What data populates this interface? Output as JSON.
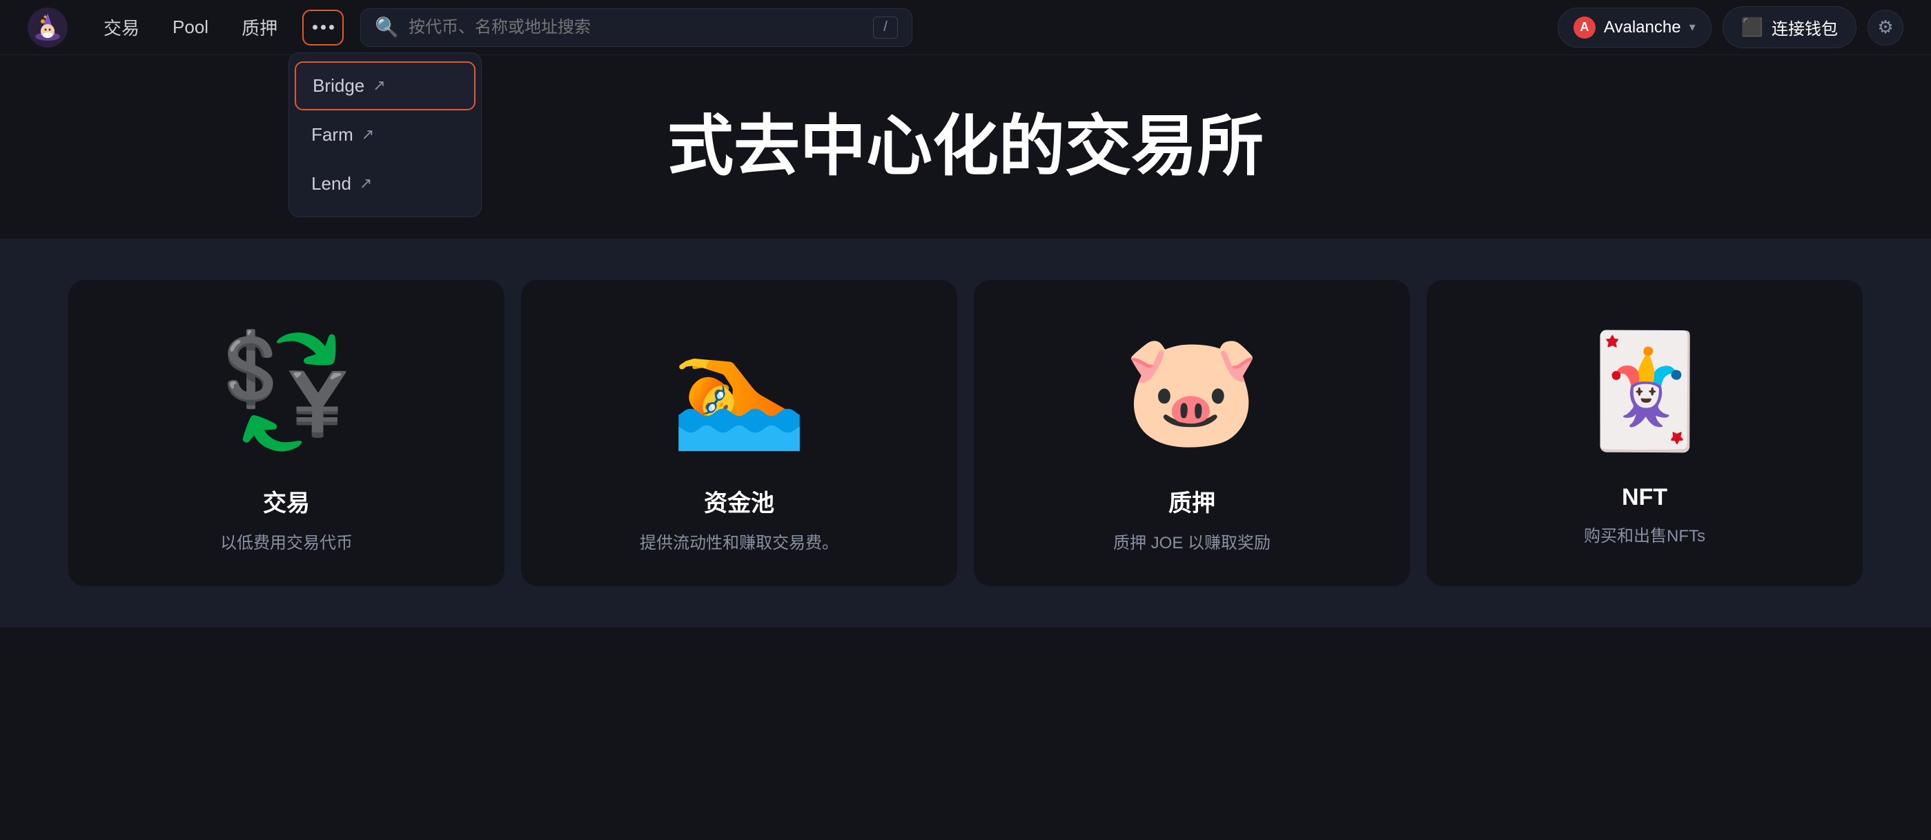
{
  "app": {
    "logo_alt": "Trader Joe logo"
  },
  "navbar": {
    "links": [
      {
        "id": "trade",
        "label": "交易"
      },
      {
        "id": "pool",
        "label": "Pool"
      },
      {
        "id": "stake",
        "label": "质押"
      }
    ],
    "more_button_label": "•••",
    "search_placeholder": "按代币、名称或地址搜索",
    "search_slash": "/",
    "network": {
      "name": "Avalanche",
      "icon": "A"
    },
    "connect_wallet": "连接钱包"
  },
  "dropdown": {
    "items": [
      {
        "id": "bridge",
        "label": "Bridge",
        "external": true,
        "highlighted": true
      },
      {
        "id": "farm",
        "label": "Farm",
        "external": true,
        "highlighted": false
      },
      {
        "id": "lend",
        "label": "Lend",
        "external": true,
        "highlighted": false
      }
    ]
  },
  "hero": {
    "title": "式去中心化的交易所"
  },
  "cards": [
    {
      "id": "trade",
      "emoji": "💱",
      "title": "交易",
      "desc": "以低费用交易代币"
    },
    {
      "id": "pool",
      "emoji": "🏊",
      "title": "资金池",
      "desc": "提供流动性和赚取交易费。"
    },
    {
      "id": "stake",
      "emoji": "🐷",
      "title": "质押",
      "desc": "质押 JOE 以赚取奖励"
    },
    {
      "id": "nft",
      "emoji": "🃏",
      "title": "NFT",
      "desc": "购买和出售NFTs"
    }
  ]
}
